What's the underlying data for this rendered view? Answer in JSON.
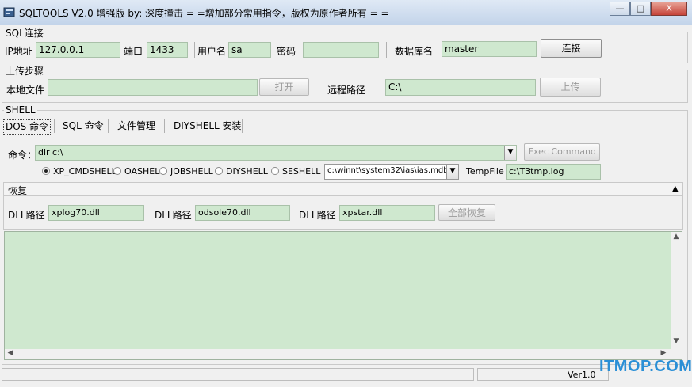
{
  "window": {
    "title": "SQLTOOLS V2.0 增强版  by: 深度撞击   = =增加部分常用指令，版权为原作者所有 = =",
    "controls": [
      "—",
      "□",
      "X"
    ]
  },
  "sql_connect": {
    "legend": "SQL连接",
    "ip_label": "IP地址",
    "ip_value": "127.0.0.1",
    "port_label": "端口",
    "port_value": "1433",
    "user_label": "用户名",
    "user_value": "sa",
    "password_label": "密码",
    "password_value": "",
    "db_label": "数据库名",
    "db_value": "master",
    "connect_button": "连接"
  },
  "upload": {
    "legend": "上传步骤",
    "local_label": "本地文件",
    "local_value": "",
    "open_button": "打开",
    "remote_label": "远程路径",
    "remote_value": "C:\\",
    "upload_button": "上传"
  },
  "shell": {
    "legend": "SHELL",
    "tabs": [
      "DOS 命令",
      "SQL 命令",
      "文件管理",
      "DIYSHELL 安装"
    ],
    "command_label": "命令：",
    "command_value": "dir c:\\",
    "exec_button": "Exec Command",
    "radios": [
      "XP_CMDSHELL",
      "OASHEL",
      "JOBSHELL",
      "DIYSHELL",
      "SESHELL"
    ],
    "mdb_path": "c:\\winnt\\system32\\ias\\ias.mdb",
    "tempfile_label": "TempFile",
    "tempfile_value": "c:\\T3tmp.log"
  },
  "restore": {
    "legend": "恢复",
    "dll_label": "DLL路径",
    "dll1": "xplog70.dll",
    "dll2": "odsole70.dll",
    "dll3": "xpstar.dll",
    "restore_all_button": "全部恢复",
    "collapse_glyph": "▲"
  },
  "output": {
    "text": "",
    "scroll_up": "▲",
    "scroll_down": "▼"
  },
  "status": {
    "version": "Ver1.0"
  },
  "watermark": "ITMOP.COM"
}
